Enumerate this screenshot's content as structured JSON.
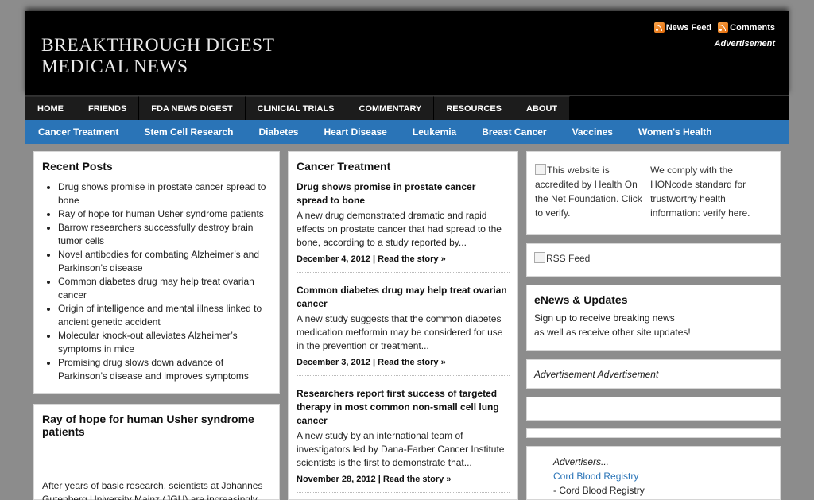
{
  "header": {
    "site_title": "BREAKTHROUGH DIGEST MEDICAL NEWS",
    "news_feed": "News Feed",
    "comments": "Comments",
    "advertisement": "Advertisement"
  },
  "nav_primary": [
    "HOME",
    "FRIENDS",
    "FDA NEWS DIGEST",
    "CLINICIAL TRIALS",
    "COMMENTARY",
    "RESOURCES",
    "ABOUT"
  ],
  "nav_secondary": [
    "Cancer Treatment",
    "Stem Cell Research",
    "Diabetes",
    "Heart Disease",
    "Leukemia",
    "Breast Cancer",
    "Vaccines",
    "Women's Health"
  ],
  "recent_posts": {
    "title": "Recent Posts",
    "items": [
      "Drug shows promise in prostate cancer spread to bone",
      "Ray of hope for human Usher syndrome patients",
      "Barrow researchers successfully destroy brain tumor cells",
      "Novel antibodies for combating Alzheimer’s and Parkinson’s disease",
      "Common diabetes drug may help treat ovarian cancer",
      "Origin of intelligence and mental illness linked to ancient genetic accident",
      "Molecular knock-out alleviates Alzheimer’s symptoms in mice",
      "Promising drug slows down advance of Parkinson’s disease and improves symptoms"
    ]
  },
  "featured": {
    "title": "Ray of hope for human Usher syndrome patients",
    "excerpt": "After years of basic research, scientists at Johannes Gutenberg University Mainz (JGU) are increasingly"
  },
  "cancer_treatment": {
    "title": "Cancer Treatment",
    "posts": [
      {
        "title": "Drug shows promise in prostate cancer spread to bone",
        "excerpt": "A new drug demonstrated dramatic and rapid effects on prostate cancer that had spread to the bone, according to a study reported by...",
        "meta": "December 4, 2012 | Read the story »"
      },
      {
        "title": "Common diabetes drug may help treat ovarian cancer",
        "excerpt": "  A new study suggests that the common diabetes medication metformin may be considered for use in the prevention or treatment...",
        "meta": "December 3, 2012 | Read the story »"
      },
      {
        "title": "Researchers report first success of targeted therapy in most common non-small cell lung cancer",
        "excerpt": "A new study by an international team of investigators led by Dana-Farber Cancer Institute scientists is the first to demonstrate that...",
        "meta": "November 28, 2012 | Read the story »"
      }
    ]
  },
  "sidebar": {
    "hon_img_alt": "This website is accredited by Health On the Net Foundation. Click to verify.",
    "hon_text": "We comply with the HONcode standard for trustworthy health information: verify here.",
    "rss_alt": "RSS Feed",
    "enews_title": "eNews & Updates",
    "enews_line1": "Sign up to receive breaking news",
    "enews_line2": "as well as receive other site updates!",
    "ads": "Advertisement Advertisement",
    "advertisers_label": "Advertisers...",
    "advertiser_link": "Cord Blood Registry",
    "advertiser_sub": "- Cord Blood Registry"
  },
  "colors": {
    "header_bg": "#000000",
    "nav_secondary_bg": "#2a74b7",
    "page_bg": "#8c8c8c",
    "link": "#2a74b7"
  }
}
